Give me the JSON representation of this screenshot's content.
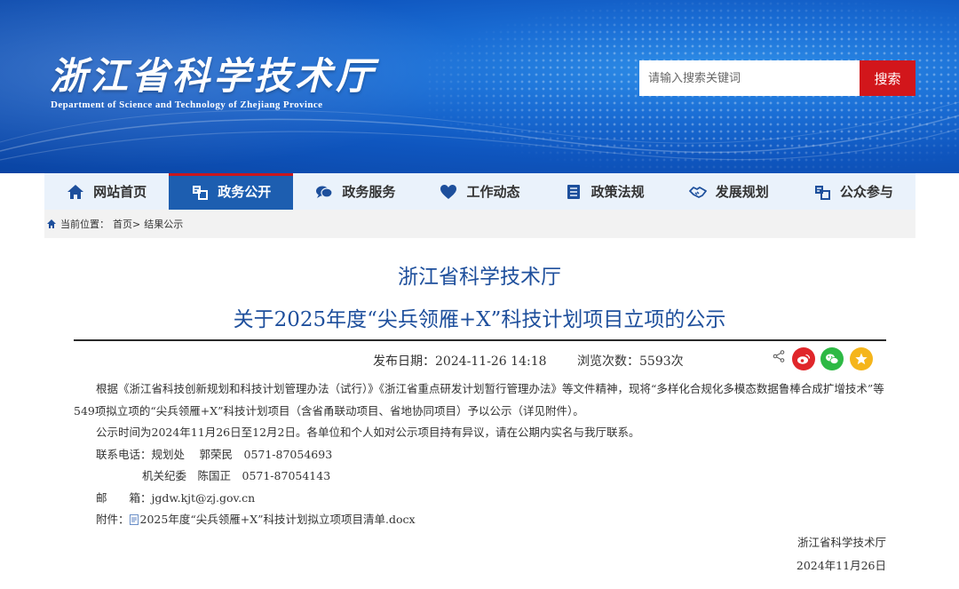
{
  "header": {
    "title": "浙江省科学技术厅",
    "subtitle": "Department of Science and Technology of Zhejiang Province",
    "search_placeholder": "请输入搜索关键词",
    "search_button": "搜索"
  },
  "nav": {
    "items": [
      {
        "label": "网站首页",
        "icon": "home-icon"
      },
      {
        "label": "政务公开",
        "icon": "open-government-icon",
        "active": true
      },
      {
        "label": "政务服务",
        "icon": "chat-bubbles-icon"
      },
      {
        "label": "工作动态",
        "icon": "heart-icon"
      },
      {
        "label": "政策法规",
        "icon": "document-list-icon"
      },
      {
        "label": "发展规划",
        "icon": "handshake-icon"
      },
      {
        "label": "公众参与",
        "icon": "participation-icon"
      }
    ]
  },
  "breadcrumb": {
    "prefix": "当前位置：",
    "home": "首页>",
    "current": "结果公示"
  },
  "article": {
    "title_line1": "浙江省科学技术厅",
    "title_line2": "关于2025年度“尖兵领雁+X”科技计划项目立项的公示",
    "publish_label": "发布日期：",
    "publish_date": "2024-11-26 14:18",
    "views_label": "浏览次数：",
    "views": "5593次",
    "para1": "根据《浙江省科技创新规划和科技计划管理办法（试行）》《浙江省重点研发计划暂行管理办法》等文件精神，现将“多样化合规化多模态数据鲁棒合成扩增技术”等549项拟立项的“尖兵领雁+X”科技计划项目（含省甬联动项目、省地协同项目）予以公示（详见附件）。",
    "para2": "公示时间为2024年11月26日至12月2日。各单位和个人如对公示项目持有异议，请在公期内实名与我厅联系。",
    "contact_label": "联系电话：",
    "contact1": "规划处　 郭荣民　0571-87054693",
    "contact2": "机关纪委　陈国正　0571-87054143",
    "email_label": "邮　　箱：",
    "email": "jgdw.kjt@zj.gov.cn",
    "attachment_label": "附件：",
    "attachment": "2025年度“尖兵领雁+X”科技计划拟立项项目清单.docx",
    "signer": "浙江省科学技术厅",
    "sign_date": "2024年11月26日"
  },
  "colors": {
    "brand_blue": "#1d5eb0",
    "title_blue": "#1e4f9c",
    "search_red": "#d2161b",
    "weibo": "#e0262a",
    "wechat": "#2db944",
    "qzone": "#f5b51b"
  }
}
